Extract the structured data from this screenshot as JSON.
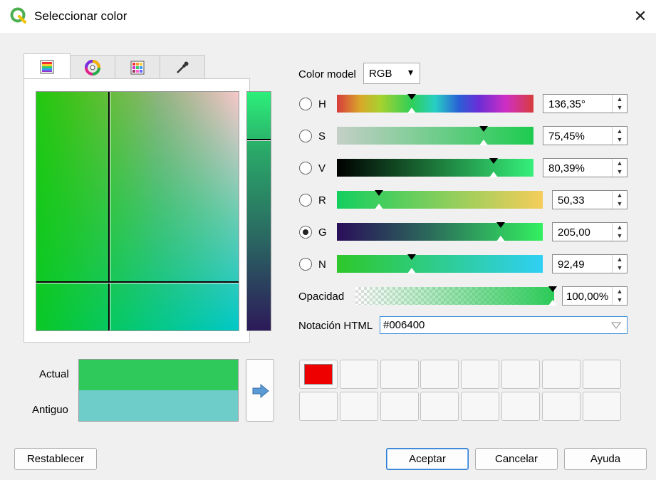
{
  "window": {
    "title": "Seleccionar color",
    "close_glyph": "✕",
    "icon": "qgis-logo-icon"
  },
  "tabs": [
    {
      "name": "color-ramp-tab",
      "icon": "color-ramp-icon",
      "active": true
    },
    {
      "name": "color-wheel-tab",
      "icon": "color-wheel-icon",
      "active": false
    },
    {
      "name": "swatch-grid-tab",
      "icon": "swatch-grid-icon",
      "active": false
    },
    {
      "name": "sample-tab",
      "icon": "eyedropper-icon",
      "active": false
    }
  ],
  "color_model": {
    "label": "Color model",
    "value": "RGB",
    "arrow": "▾"
  },
  "channels": [
    {
      "key": "H",
      "label": "H",
      "value": "136,35°",
      "level": 0.38,
      "checked": false
    },
    {
      "key": "S",
      "label": "S",
      "value": "75,45%",
      "level": 0.75,
      "checked": false
    },
    {
      "key": "V",
      "label": "V",
      "value": "80,39%",
      "level": 0.8,
      "checked": false
    },
    {
      "key": "R",
      "label": "R",
      "value": "50,33",
      "level": 0.2,
      "checked": false
    },
    {
      "key": "G",
      "label": "G",
      "value": "205,00",
      "level": 0.8,
      "checked": true
    },
    {
      "key": "N",
      "label": "N",
      "value": "92,49",
      "level": 0.36,
      "checked": false
    }
  ],
  "opacity": {
    "label": "Opacidad",
    "value": "100,00%",
    "level": 1.0
  },
  "html_notation": {
    "label": "Notación HTML",
    "value": "#006400"
  },
  "preview": {
    "actual_label": "Actual",
    "old_label": "Antiguo",
    "actual_color": "#2ec95a",
    "old_color": "#6ecdc9"
  },
  "swatches": [
    "#ee0000",
    "",
    "",
    "",
    "",
    "",
    "",
    "",
    "",
    "",
    "",
    "",
    "",
    "",
    "",
    ""
  ],
  "buttons": {
    "reset": "Restablecer",
    "ok": "Aceptar",
    "cancel": "Cancelar",
    "help": "Ayuda"
  },
  "spin_arrows": {
    "up": "▲",
    "down": "▼"
  }
}
